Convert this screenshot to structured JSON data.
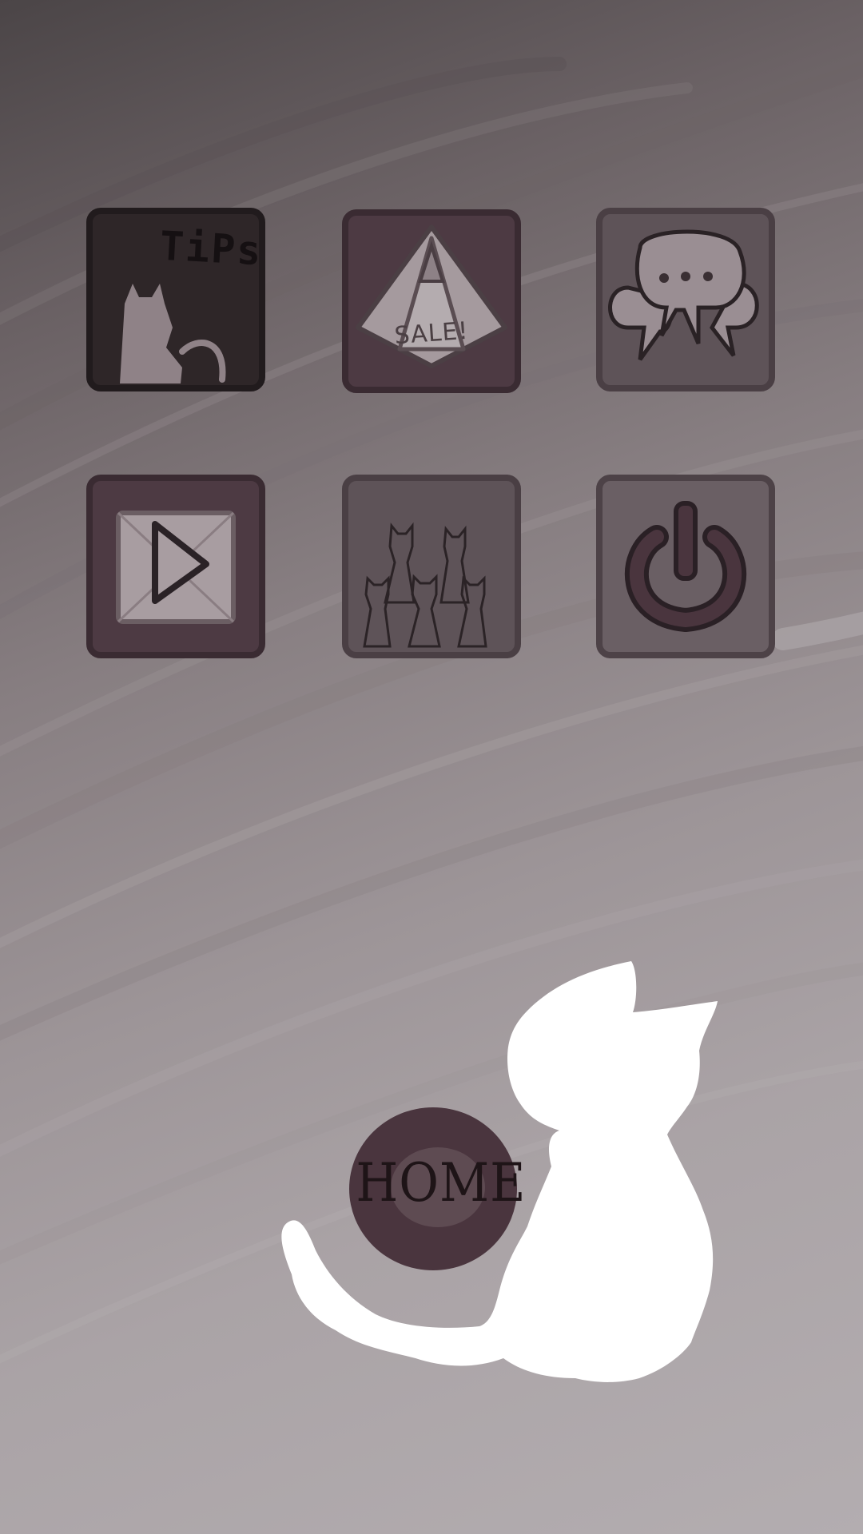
{
  "menu": {
    "tiles": [
      {
        "id": "tips",
        "label": "TiPs",
        "icon": "tips-cat-icon"
      },
      {
        "id": "shop",
        "label": "SALE!",
        "icon": "sale-tag-icon"
      },
      {
        "id": "chat",
        "label": "",
        "icon": "speech-bubbles-icon"
      },
      {
        "id": "play",
        "label": "",
        "icon": "play-icon"
      },
      {
        "id": "cats",
        "label": "",
        "icon": "cat-group-icon"
      },
      {
        "id": "power",
        "label": "",
        "icon": "power-icon"
      }
    ]
  },
  "home": {
    "label": "HOME"
  },
  "colors": {
    "tile_dark": "#2e2628",
    "tile_mauve": "#4d3a43",
    "tile_gray": "#5e5358",
    "home_button": "#4a353e",
    "cat": "#ffffff"
  }
}
